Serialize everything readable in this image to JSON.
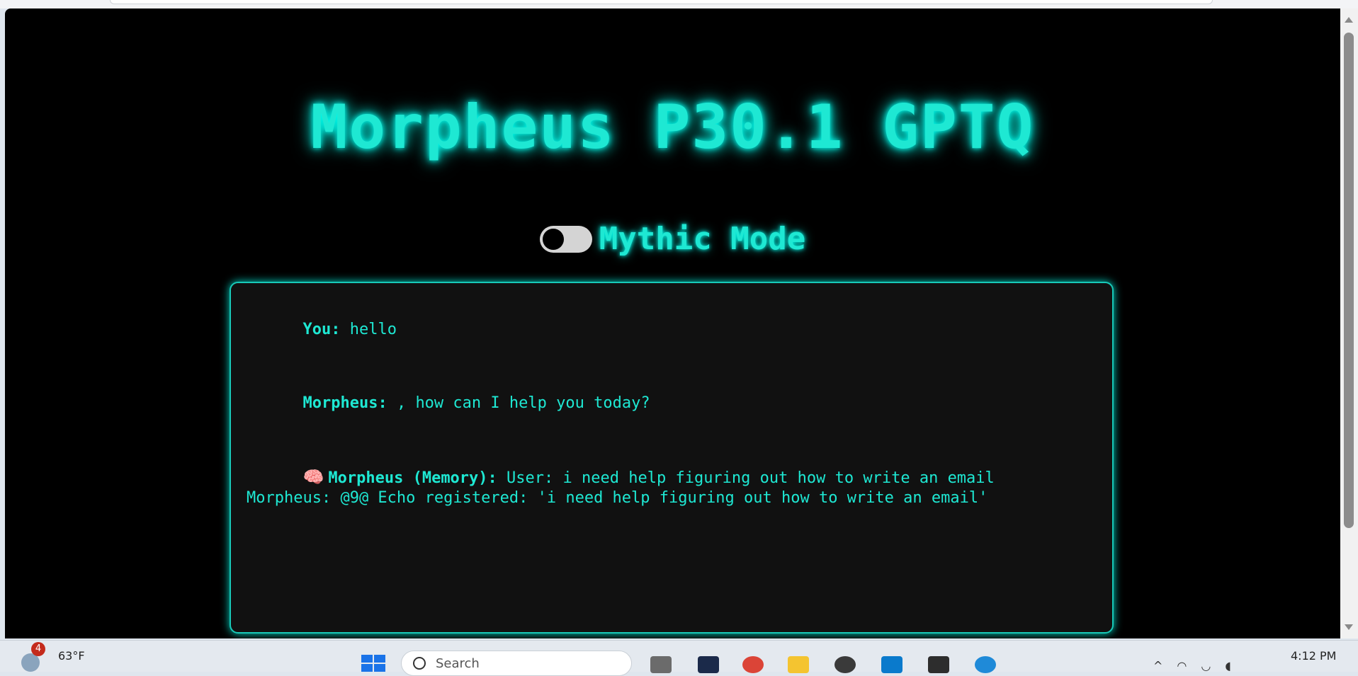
{
  "app": {
    "title": "Morpheus P30.1 GPTQ",
    "mode_label": "Mythic Mode",
    "mode_enabled": false
  },
  "chat": {
    "messages": [
      {
        "speaker": "You:",
        "text": " hello"
      },
      {
        "speaker": "Morpheus:",
        "text": " , how can I help you today?"
      },
      {
        "icon": "brain-icon",
        "speaker": "Morpheus (Memory):",
        "text": " User: i need help figuring out how to write an email\nMorpheus: @9@ Echo registered: 'i need help figuring out how to write an email'"
      }
    ]
  },
  "taskbar": {
    "weather_badge": "4",
    "temperature": "63°F",
    "search_placeholder": "Search",
    "clock": "4:12 PM",
    "apps": [
      "windows-icon",
      "task-view-icon",
      "powershell-icon",
      "chrome-icon",
      "file-explorer-icon",
      "chatgpt-icon",
      "vscode-icon",
      "terminal-icon",
      "edge-icon"
    ]
  },
  "colors": {
    "accent": "#1ee8d3",
    "background": "#000000",
    "chat_bg": "#111111"
  }
}
